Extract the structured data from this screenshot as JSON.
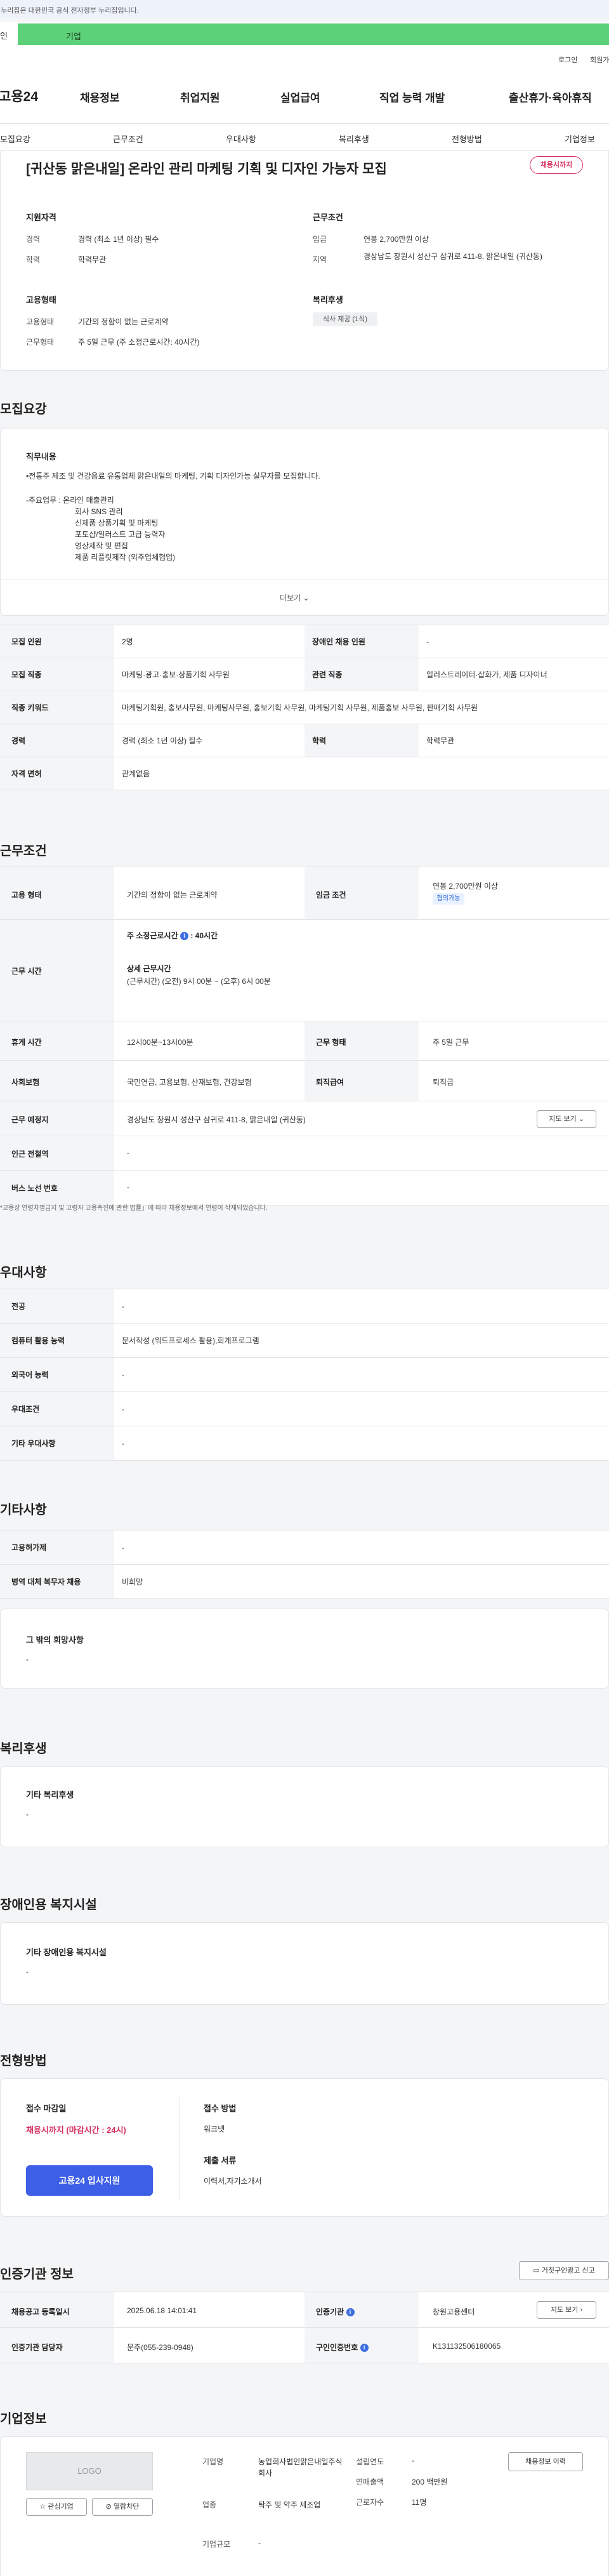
{
  "gov_banner": "이 누리집은 대한민국 공식 전자정부 누리집입니다.",
  "site_tabs": {
    "individual": "개인",
    "enterprise": "기업"
  },
  "util": {
    "login": "로그인",
    "signup": "회원가입"
  },
  "logo": "고용24",
  "gnb": [
    "채용정보",
    "취업지원",
    "실업급여",
    "직업 능력 개발",
    "출산휴가·육아휴직"
  ],
  "subnav": [
    "모집요강",
    "근무조건",
    "우대사항",
    "복리후생",
    "전형방법",
    "기업정보"
  ],
  "summary": {
    "title": "[귀산동 맑은내일] 온라인 관리 마케팅 기획 및 디자인 가능자 모집",
    "badge": "채용시까지",
    "qual_title": "지원자격",
    "career_lbl": "경력",
    "career_val": "경력 (최소 1년 이상) 필수",
    "edu_lbl": "학력",
    "edu_val": "학력무관",
    "cond_title": "근무조건",
    "wage_lbl": "임금",
    "wage_val": "연봉 2,700만원 이상",
    "region_lbl": "지역",
    "region_val": "경상남도 창원시 성산구 삼귀로 411-8, 맑은내일 (귀산동)",
    "emp_title": "고용형태",
    "emptype_lbl": "고용형태",
    "emptype_val": "기간의 정함이 없는 근로계약",
    "worktype_lbl": "근무형태",
    "worktype_val": "주 5일 근무 (주 소정근로시간: 40시간)",
    "welfare_title": "복리후생",
    "welfare_pill": "식사 제공 (1식)"
  },
  "recruit": {
    "heading": "모집요강",
    "duty_title": "직무내용",
    "duty_lines": [
      "•전통주 제조 및 건강음료 유통업체 맑은내일의 마케팅, 기획 디자인가능 실무자를 모집합니다.",
      "",
      "-주요업무 : 온라인 매출관리",
      "회사 SNS 관리",
      "신제품 상품기획 및  마케팅",
      "포토샵/일러스트 고급 능력자",
      "영상제작 및 편집",
      "제품 리플릿제작 (외주업체협업)"
    ],
    "more": "더보기",
    "rows": [
      {
        "l1": "모집 인원",
        "v1": "2명",
        "l2": "장애인 채용 인원",
        "v2": "-"
      },
      {
        "l1": "모집 직종",
        "v1": "마케팅·광고·홍보·상품기획 사무원",
        "l2": "관련 직종",
        "v2": "일러스트레이터·삽화가, 제품 디자이너"
      },
      {
        "l1": "직종 키워드",
        "v1": "마케팅기획원, 홍보사무원, 마케팅사무원, 홍보기획 사무원, 마케팅기획 사무원, 제품홍보 사무원, 판매기획 사무원"
      },
      {
        "l1": "경력",
        "v1": "경력 (최소 1년 이상) 필수",
        "l2": "학력",
        "v2": "학력무관"
      },
      {
        "l1": "자격 면허",
        "v1": "관계없음"
      }
    ]
  },
  "work": {
    "heading": "근무조건",
    "emptype_lbl": "고용 형태",
    "emptype_val": "기간의 정함이 없는 근로계약",
    "wage_lbl": "임금 조건",
    "wage_val": "연봉 2,700만원 이상",
    "wage_tag": "협의가능",
    "hours_lbl": "근무 시간",
    "weekly": "주 소정근로시간",
    "weekly_val": ": 40시간",
    "detail_title": "상세 근무시간",
    "detail_val": "(근무시간) (오전) 9시 00분 ~ (오후) 6시 00분",
    "rest_lbl": "휴게 시간",
    "rest_val": "12시00분~13시00분",
    "form_lbl": "근무 형태",
    "form_val": "주 5일 근무",
    "ins_lbl": "사회보험",
    "ins_val": "국민연금, 고용보험, 산재보험, 건강보험",
    "sev_lbl": "퇴직급여",
    "sev_val": "퇴직금",
    "place_lbl": "근무 예정지",
    "place_val": "경상남도 창원시 성산구 삼귀로 411-8, 맑은내일 (귀산동)",
    "map_btn": "지도 보기",
    "subway_lbl": "인근 전철역",
    "subway_val": "-",
    "bus_lbl": "버스 노선 번호",
    "bus_val": "-",
    "note": "*고용상 연령차별금지 및 고령자 고용촉진에 관한 법률」에 따라 채용정보에서 연령이 삭제되었습니다."
  },
  "pref": {
    "heading": "우대사항",
    "rows": [
      {
        "l": "전공",
        "v": "-"
      },
      {
        "l": "컴퓨터 활용 능력",
        "v": "문서작성 (워드프로세스 활용),회계프로그램"
      },
      {
        "l": "외국어 능력",
        "v": "-"
      },
      {
        "l": "우대조건",
        "v": "-"
      },
      {
        "l": "기타 우대사항",
        "v": "-"
      }
    ]
  },
  "etc": {
    "heading": "기타사항",
    "rows": [
      {
        "l": "고용허가제",
        "v": "-"
      },
      {
        "l": "병역 대체 복무자 채용",
        "v": "비희망"
      }
    ],
    "other_title": "그 밖의 희망사항",
    "other_val": "-"
  },
  "welfare": {
    "heading": "복리후생",
    "title": "기타 복리후생",
    "val": "-"
  },
  "disabled": {
    "heading": "장애인용 복지시설",
    "title": "기타 장애인용 복지시설",
    "val": "-"
  },
  "screening": {
    "heading": "전형방법",
    "deadline_title": "접수 마감일",
    "deadline_val": "채용시까지 (마감시간 : 24시)",
    "method_title": "접수 방법",
    "method_val": "워크넷",
    "docs_title": "제출 서류",
    "docs_val": "이력서,자기소개서",
    "apply_btn": "고용24 입사지원"
  },
  "agency": {
    "heading": "인증기관 정보",
    "report_btn": "거짓구인광고 신고",
    "reg_lbl": "채용공고 등록일시",
    "reg_val": "2025.06.18 14:01:41",
    "org_lbl": "인증기관",
    "org_val": "창원고용센터",
    "map_btn": "지도 보기",
    "mgr_lbl": "인증기관 담당자",
    "mgr_val": "문주(055-239-0948)",
    "id_lbl": "구인인증번호",
    "id_val": "K131132506180065"
  },
  "company": {
    "heading": "기업정보",
    "logo_text": "LOGO",
    "interest_btn": "관심기업",
    "block_btn": "열람차단",
    "name_lbl": "기업명",
    "name_val": "농업회사법인맑은내일주식회사",
    "ind_lbl": "업종",
    "ind_val": "탁주 및 약주 제조업",
    "size_lbl": "기업규모",
    "size_val": "-",
    "est_lbl": "설립연도",
    "est_val": "-",
    "sales_lbl": "연매출액",
    "sales_val": "200 백만원",
    "emp_lbl": "근로자수",
    "emp_val": "11명",
    "hist_btn": "채용정보 이력"
  }
}
